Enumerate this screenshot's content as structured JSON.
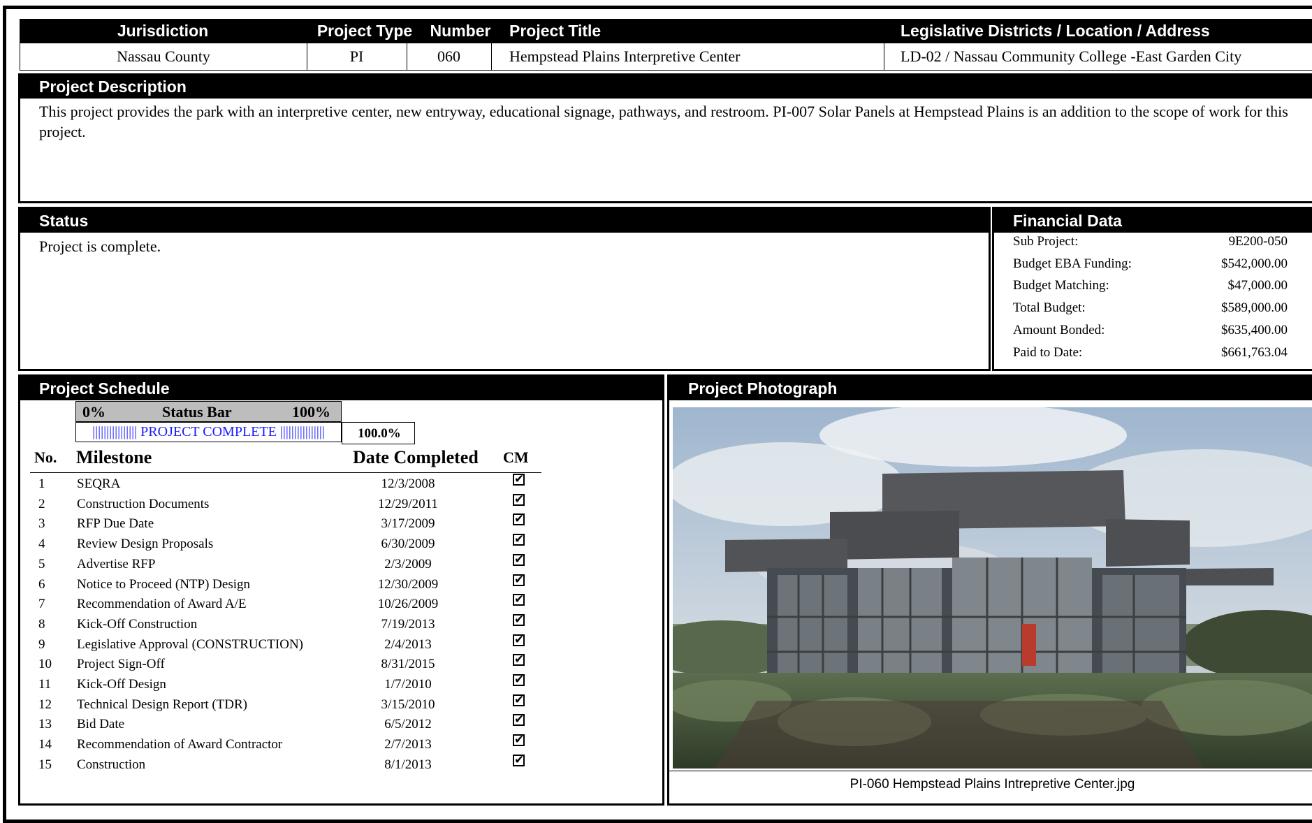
{
  "header": {
    "columns": [
      "Jurisdiction",
      "Project Type",
      "Number",
      "Project Title",
      "Legislative Districts / Location / Address"
    ],
    "jurisdiction": "Nassau County",
    "project_type": "PI",
    "number": "060",
    "project_title": "Hempstead Plains Interpretive Center",
    "location": "LD-02 / Nassau Community College -East Garden City"
  },
  "description": {
    "title": "Project Description",
    "text": "This project provides the park with an interpretive center, new entryway, educational signage, pathways, and restroom. PI-007 Solar Panels at Hempstead Plains is an addition to the scope of work for this project."
  },
  "status": {
    "title": "Status",
    "text": "Project is complete."
  },
  "financial": {
    "title": "Financial Data",
    "rows": [
      {
        "label": "Sub Project:",
        "value": "9E200-050"
      },
      {
        "label": "Budget EBA Funding:",
        "value": "$542,000.00"
      },
      {
        "label": "Budget Matching:",
        "value": "$47,000.00"
      },
      {
        "label": "Total Budget:",
        "value": "$589,000.00"
      },
      {
        "label": "Amount Bonded:",
        "value": "$635,400.00"
      },
      {
        "label": "Paid to Date:",
        "value": "$661,763.04"
      }
    ]
  },
  "schedule": {
    "title": "Project Schedule",
    "status_bar": {
      "min_label": "0%",
      "title": "Status Bar",
      "max_label": "100%",
      "bar_text": "|||||||||||||||| PROJECT COMPLETE ||||||||||||||||",
      "percent_text": "100.0%",
      "progress_fraction": 1.0,
      "bar_color": "#1a1aff"
    },
    "columns": {
      "no": "No.",
      "milestone": "Milestone",
      "date": "Date Completed",
      "cm": "CM"
    },
    "milestones": [
      {
        "no": "1",
        "name": "SEQRA",
        "date": "12/3/2008",
        "cm": true
      },
      {
        "no": "2",
        "name": "Construction Documents",
        "date": "12/29/2011",
        "cm": true
      },
      {
        "no": "3",
        "name": "RFP Due Date",
        "date": "3/17/2009",
        "cm": true
      },
      {
        "no": "4",
        "name": "Review Design Proposals",
        "date": "6/30/2009",
        "cm": true
      },
      {
        "no": "5",
        "name": "Advertise RFP",
        "date": "2/3/2009",
        "cm": true
      },
      {
        "no": "6",
        "name": "Notice to Proceed (NTP) Design",
        "date": "12/30/2009",
        "cm": true
      },
      {
        "no": "7",
        "name": "Recommendation of Award A/E",
        "date": "10/26/2009",
        "cm": true
      },
      {
        "no": "8",
        "name": "Kick-Off Construction",
        "date": "7/19/2013",
        "cm": true
      },
      {
        "no": "9",
        "name": "Legislative Approval (CONSTRUCTION)",
        "date": "2/4/2013",
        "cm": true
      },
      {
        "no": "10",
        "name": "Project Sign-Off",
        "date": "8/31/2015",
        "cm": true
      },
      {
        "no": "11",
        "name": "Kick-Off Design",
        "date": "1/7/2010",
        "cm": true
      },
      {
        "no": "12",
        "name": "Technical Design Report (TDR)",
        "date": "3/15/2010",
        "cm": true
      },
      {
        "no": "13",
        "name": "Bid Date",
        "date": "6/5/2012",
        "cm": true
      },
      {
        "no": "14",
        "name": "Recommendation of Award Contractor",
        "date": "2/7/2013",
        "cm": true
      },
      {
        "no": "15",
        "name": "Construction",
        "date": "8/1/2013",
        "cm": true
      }
    ]
  },
  "photo": {
    "title": "Project Photograph",
    "caption": "PI-060 Hempstead Plains Intrepretive Center.jpg"
  }
}
